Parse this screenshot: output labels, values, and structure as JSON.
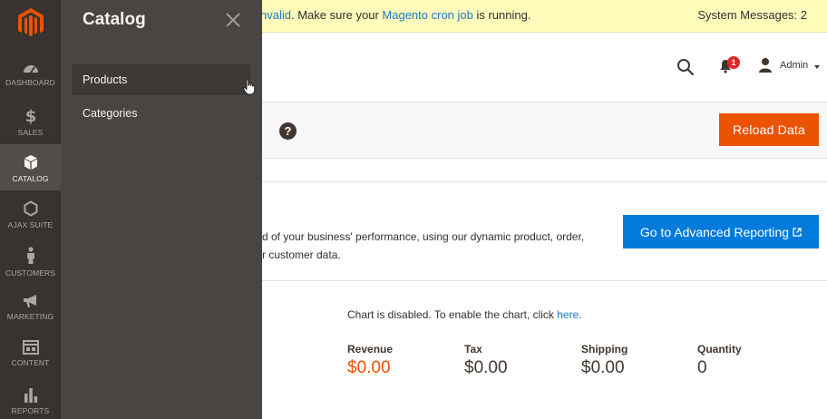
{
  "system_message": {
    "prefix": "nvalid",
    "middle": ". Make sure your ",
    "link": "Magento cron job",
    "suffix": " is running.",
    "count_label": "System Messages: 2"
  },
  "nav": {
    "items": [
      {
        "label": "DASHBOARD",
        "icon": "dashboard-icon"
      },
      {
        "label": "SALES",
        "icon": "dollar-icon"
      },
      {
        "label": "CATALOG",
        "icon": "box-icon"
      },
      {
        "label": "AJAX SUITE",
        "icon": "hexagon-icon"
      },
      {
        "label": "CUSTOMERS",
        "icon": "person-icon"
      },
      {
        "label": "MARKETING",
        "icon": "megaphone-icon"
      },
      {
        "label": "CONTENT",
        "icon": "layout-icon"
      },
      {
        "label": "REPORTS",
        "icon": "bar-chart-icon"
      }
    ]
  },
  "flyout": {
    "title": "Catalog",
    "items": [
      {
        "label": "Products"
      },
      {
        "label": "Categories"
      }
    ]
  },
  "header": {
    "notification_count": "1",
    "user_name": "Admin"
  },
  "actions": {
    "reload_label": "Reload Data",
    "help_label": "?"
  },
  "advanced": {
    "line1": "d of your business' performance, using our dynamic product, order,",
    "line2": "r customer data.",
    "button_label": "Go to Advanced Reporting"
  },
  "chart_note": {
    "text": "Chart is disabled. To enable the chart, click ",
    "link": "here",
    "suffix": "."
  },
  "totals": [
    {
      "label": "Revenue",
      "value": "$0.00"
    },
    {
      "label": "Tax",
      "value": "$0.00"
    },
    {
      "label": "Shipping",
      "value": "$0.00"
    },
    {
      "label": "Quantity",
      "value": "0"
    }
  ],
  "colors": {
    "accent": "#eb5202",
    "link": "#1979c3",
    "primary_button": "#007bdb",
    "nav_bg": "#373330",
    "flyout_bg": "#4a4542"
  }
}
